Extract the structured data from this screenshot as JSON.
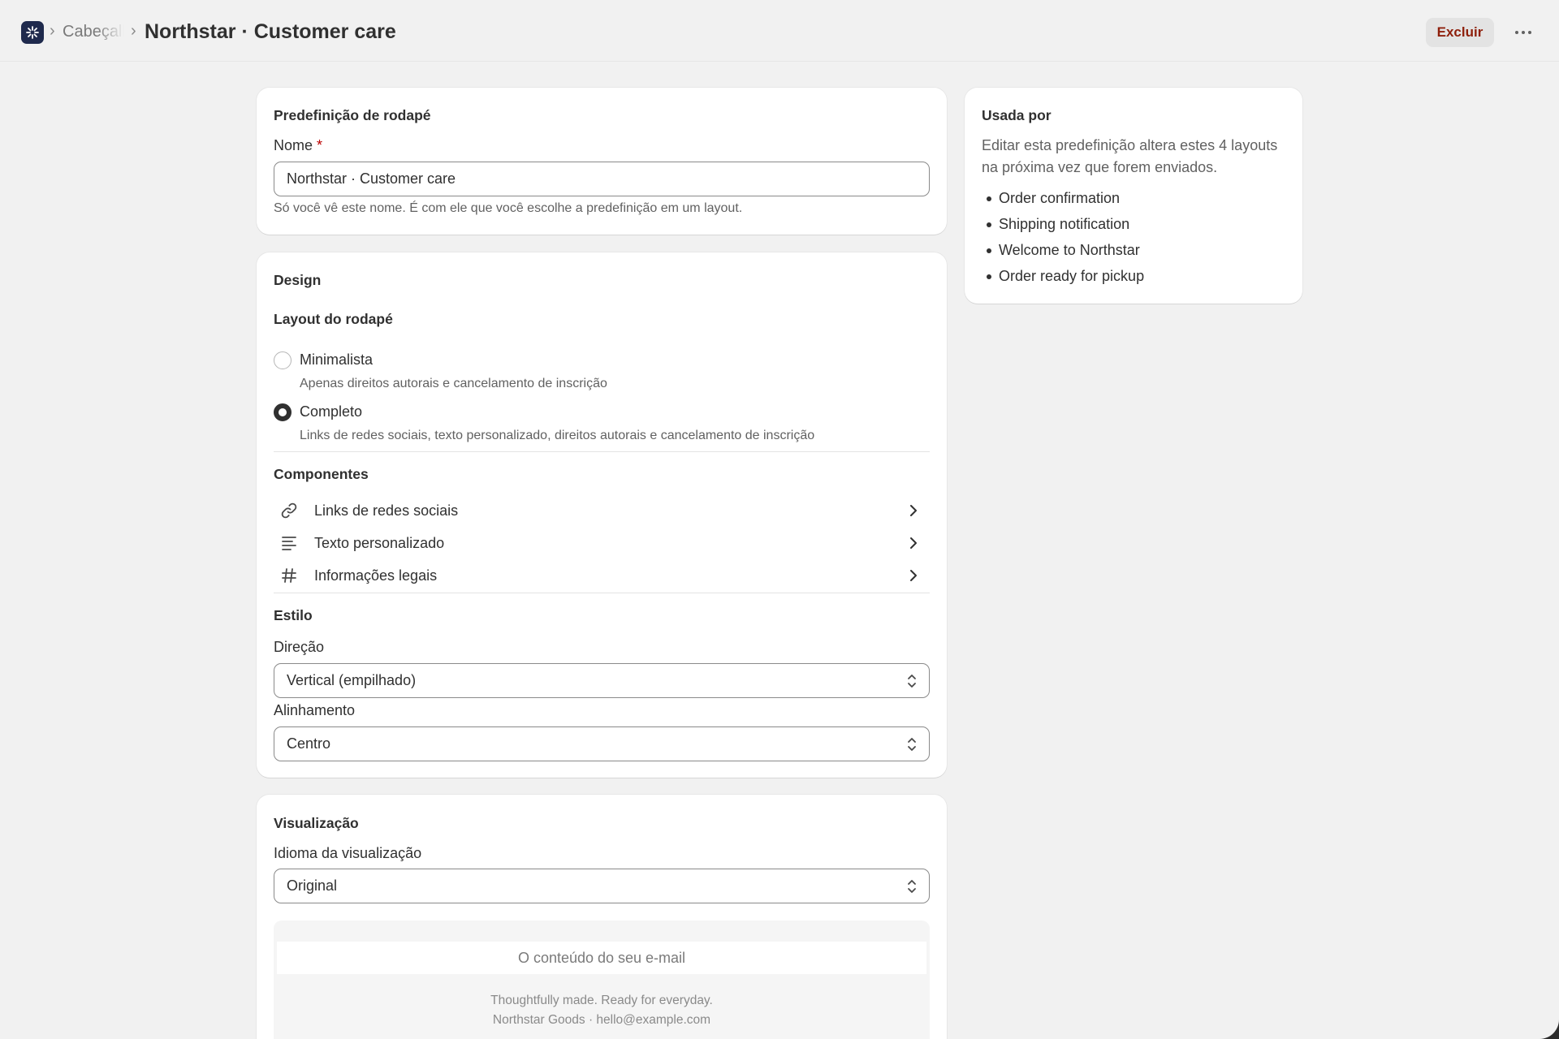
{
  "header": {
    "breadcrumb_parent": "Cabeçalho",
    "title": "Northstar · Customer care",
    "delete_label": "Excluir"
  },
  "preset": {
    "section_title": "Predefinição de rodapé",
    "name_label": "Nome",
    "required_mark": "*",
    "name_value": "Northstar · Customer care",
    "name_help": "Só você vê este nome. É com ele que você escolhe a predefinição em um layout."
  },
  "design": {
    "section_title": "Design",
    "layout_title": "Layout do rodapé",
    "options": [
      {
        "label": "Minimalista",
        "description": "Apenas direitos autorais e cancelamento de inscrição",
        "selected": false
      },
      {
        "label": "Completo",
        "description": "Links de redes sociais, texto personalizado, direitos autorais e cancelamento de inscrição",
        "selected": true
      }
    ],
    "components_title": "Componentes",
    "components": [
      {
        "label": "Links de redes sociais",
        "icon": "link-icon"
      },
      {
        "label": "Texto personalizado",
        "icon": "text-align-icon"
      },
      {
        "label": "Informações legais",
        "icon": "hash-icon"
      }
    ],
    "style_title": "Estilo",
    "direction_label": "Direção",
    "direction_value": "Vertical (empilhado)",
    "alignment_label": "Alinhamento",
    "alignment_value": "Centro"
  },
  "preview": {
    "section_title": "Visualização",
    "language_label": "Idioma da visualização",
    "language_value": "Original",
    "content_placeholder": "O conteúdo do seu e-mail",
    "footer_line1": "Thoughtfully made. Ready for everyday.",
    "footer_line2": "Northstar Goods · hello@example.com"
  },
  "used_by": {
    "title": "Usada por",
    "description": "Editar esta predefinição altera estes 4 layouts na próxima vez que forem enviados.",
    "items": [
      "Order confirmation",
      "Shipping notification",
      "Welcome to Northstar",
      "Order ready for pickup"
    ]
  },
  "colors": {
    "accent_dark": "#1f2a4d",
    "danger_text": "#8e1f0b",
    "page_bg": "#f1f1f1"
  }
}
